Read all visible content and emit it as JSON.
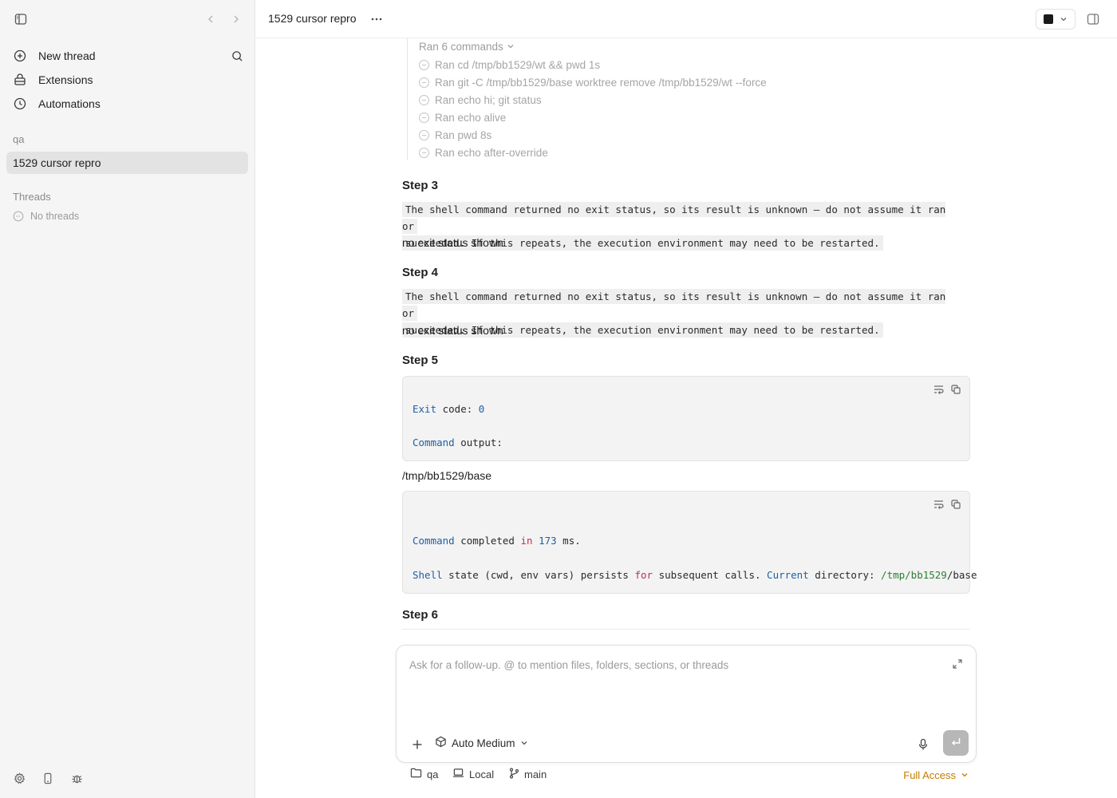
{
  "sidebar": {
    "nav": [
      {
        "label": "New thread",
        "icon": "plus-circle-icon"
      },
      {
        "label": "Extensions",
        "icon": "extensions-icon"
      },
      {
        "label": "Automations",
        "icon": "clock-icon"
      }
    ],
    "section_workspace": "qa",
    "active_thread": "1529 cursor repro",
    "section_threads": "Threads",
    "no_threads": "No threads"
  },
  "header": {
    "title": "1529 cursor repro"
  },
  "commands": {
    "summary": "Ran 6 commands",
    "items": [
      "Ran cd /tmp/bb1529/wt && pwd 1s",
      "Ran git -C /tmp/bb1529/base worktree remove /tmp/bb1529/wt --force",
      "Ran echo hi; git status",
      "Ran echo alive",
      "Ran pwd 8s",
      "Ran echo after-override"
    ]
  },
  "steps": {
    "s3": {
      "heading": "Step 3",
      "warn_line1": "The shell command returned no exit status, so its result is unknown — do not assume it ran or",
      "warn_line2": "succeeded. If this repeats, the execution environment may need to be restarted.",
      "note": "no exit status shown"
    },
    "s4": {
      "heading": "Step 4",
      "warn_line1": "The shell command returned no exit status, so its result is unknown — do not assume it ran or",
      "warn_line2": "succeeded. If this repeats, the execution environment may need to be restarted.",
      "note": "no exit status shown"
    },
    "s5": {
      "heading": "Step 5",
      "code1": {
        "exit_kw": "Exit",
        "exit_rest": " code: ",
        "exit_val": "0",
        "cmd_kw": "Command",
        "cmd_rest": " output:"
      },
      "output_path": "/tmp/bb1529/base",
      "code2": {
        "l1_kw": "Command",
        "l1_a": " completed ",
        "l1_in": "in",
        "l1_sp": " ",
        "l1_num": "173",
        "l1_b": " ms.",
        "l2_kw": "Shell",
        "l2_a": " state (cwd, env vars) persists ",
        "l2_for": "for",
        "l2_b": " subsequent calls. ",
        "l2_cur": "Current",
        "l2_c": " directory: ",
        "l2_path": "/tmp/bb1529",
        "l2_d": "/base"
      }
    },
    "s6": {
      "heading": "Step 6"
    }
  },
  "composer": {
    "placeholder": "Ask for a follow-up. @ to mention files, folders, sections, or threads",
    "model": "Auto Medium"
  },
  "footer": {
    "folder": "qa",
    "env": "Local",
    "branch": "main",
    "access": "Full Access"
  },
  "colors": {
    "access": "#c47a00",
    "send_disabled": "#b7b7b7",
    "active_thread_bg": "#e3e3e3"
  }
}
